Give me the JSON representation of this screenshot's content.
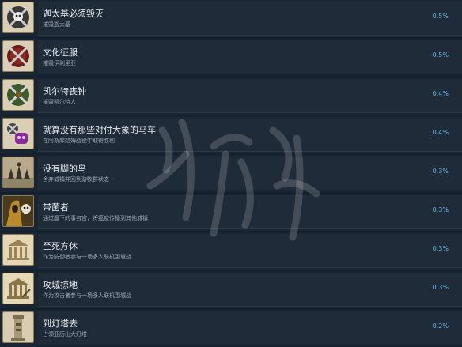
{
  "achievements": [
    {
      "title": "迦太基必须毁灭",
      "desc": "摧毁迦太基",
      "pct": "0.5%",
      "icon": "crossed-swords-skull-icon"
    },
    {
      "title": "文化征服",
      "desc": "摧毁伊利里亚",
      "pct": "0.5%",
      "icon": "crossed-swords-shield-icon"
    },
    {
      "title": "凯尔特丧钟",
      "desc": "摧毁凯尔特人",
      "pct": "0.4%",
      "icon": "crossed-swords-icon"
    },
    {
      "title": "就算没有那些对付大象的马车",
      "desc": "在阿斯库路姆战役中取得胜利",
      "pct": "0.4%",
      "icon": "battle-elephant-icon"
    },
    {
      "title": "没有脚的鸟",
      "desc": "舍弃城镇并回到游牧群状态",
      "pct": "0.3%",
      "icon": "nomad-riders-icon"
    },
    {
      "title": "带菌者",
      "desc": "通过履下的事务官，将瘟疫传播到其他城镇",
      "pct": "0.3%",
      "icon": "plague-skull-icon"
    },
    {
      "title": "至死方休",
      "desc": "作为防御者参与一场多人联机围城战",
      "pct": "0.3%",
      "icon": "temple-defender-icon"
    },
    {
      "title": "攻城掠地",
      "desc": "作为攻击者参与一场多人联机围城战",
      "pct": "0.3%",
      "icon": "temple-attacker-icon"
    },
    {
      "title": "到灯塔去",
      "desc": "占领亚历山大灯塔",
      "pct": "0.2%",
      "icon": "lighthouse-icon"
    }
  ],
  "colors": {
    "background": "#16202d",
    "row": "#1f2b38",
    "title": "#e8ecef",
    "desc": "#9aa6b2",
    "percent": "#67b6ea",
    "icon_border": "#8d7a52"
  }
}
